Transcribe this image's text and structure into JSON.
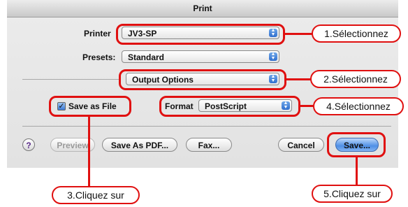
{
  "window": {
    "title": "Print"
  },
  "form": {
    "printer_label": "Printer",
    "printer_value": "JV3-SP",
    "presets_label": "Presets:",
    "presets_value": "Standard",
    "panel_value": "Output Options",
    "save_as_file_label": "Save as File",
    "save_as_file_checked": true,
    "format_label": "Format",
    "format_value": "PostScript"
  },
  "buttons": {
    "help": "?",
    "preview": "Preview",
    "save_pdf": "Save As PDF...",
    "fax": "Fax...",
    "cancel": "Cancel",
    "save": "Save..."
  },
  "callouts": {
    "c1": "1.Sélectionnez",
    "c2": "2.Sélectionnez",
    "c3": "3.Cliquez sur",
    "c4": "4.Sélectionnez",
    "c5": "5.Cliquez sur"
  },
  "colors": {
    "annotation": "#e01010",
    "default_button": "#4f8fe6"
  }
}
